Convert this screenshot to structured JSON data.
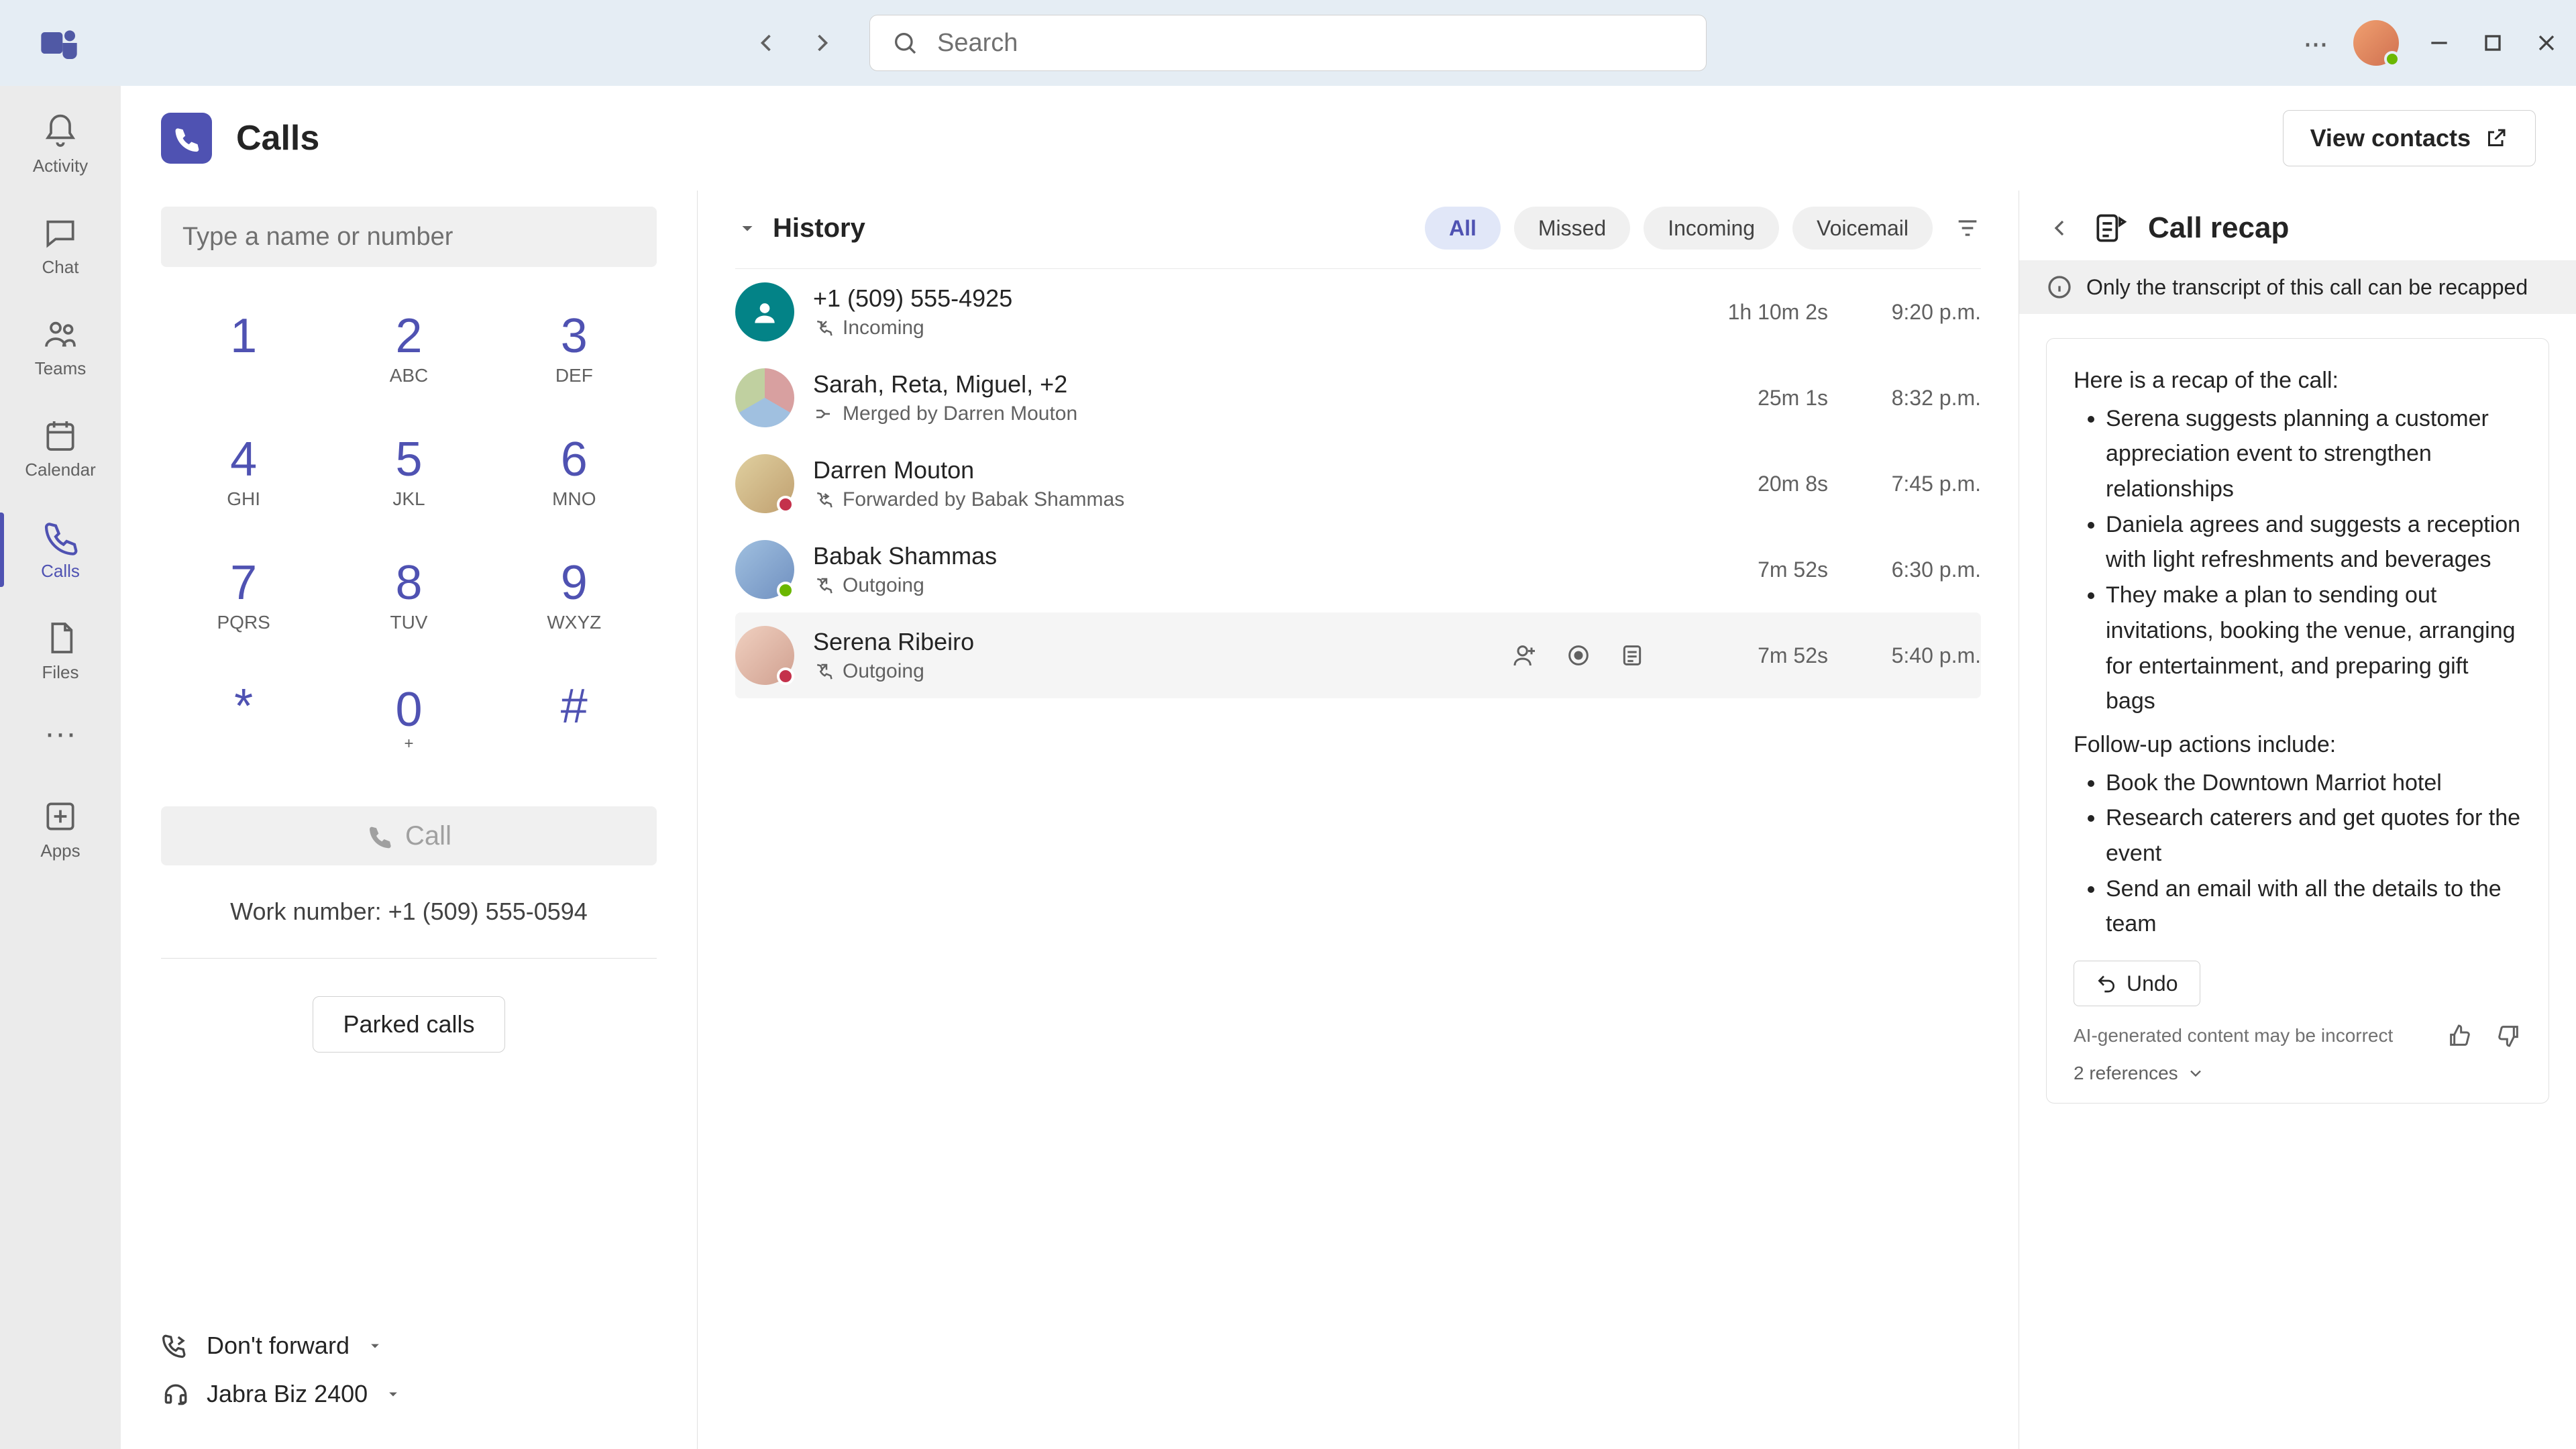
{
  "titlebar": {
    "search_placeholder": "Search"
  },
  "apprail": {
    "items": [
      {
        "label": "Activity"
      },
      {
        "label": "Chat"
      },
      {
        "label": "Teams"
      },
      {
        "label": "Calendar"
      },
      {
        "label": "Calls"
      },
      {
        "label": "Files"
      }
    ],
    "apps_label": "Apps"
  },
  "page": {
    "title": "Calls",
    "view_contacts": "View contacts"
  },
  "dialer": {
    "input_placeholder": "Type a name or number",
    "keys": [
      {
        "d": "1",
        "l": ""
      },
      {
        "d": "2",
        "l": "ABC"
      },
      {
        "d": "3",
        "l": "DEF"
      },
      {
        "d": "4",
        "l": "GHI"
      },
      {
        "d": "5",
        "l": "JKL"
      },
      {
        "d": "6",
        "l": "MNO"
      },
      {
        "d": "7",
        "l": "PQRS"
      },
      {
        "d": "8",
        "l": "TUV"
      },
      {
        "d": "9",
        "l": "WXYZ"
      },
      {
        "d": "*",
        "l": ""
      },
      {
        "d": "0",
        "l": "+"
      },
      {
        "d": "#",
        "l": ""
      }
    ],
    "call_label": "Call",
    "work_number": "Work number: +1 (509) 555-0594",
    "parked_label": "Parked calls",
    "forward_label": "Don't forward",
    "device_label": "Jabra Biz 2400"
  },
  "history": {
    "title": "History",
    "filters": {
      "all": "All",
      "missed": "Missed",
      "incoming": "Incoming",
      "voicemail": "Voicemail"
    },
    "rows": [
      {
        "name": "+1 (509) 555-4925",
        "sub": "Incoming",
        "dur": "1h 10m 2s",
        "time": "9:20 p.m.",
        "type": "incoming",
        "avatar": "teal",
        "presence": ""
      },
      {
        "name": "Sarah, Reta, Miguel, +2",
        "sub": "Merged by Darren Mouton",
        "dur": "25m 1s",
        "time": "8:32 p.m.",
        "type": "merged",
        "avatar": "multi",
        "presence": ""
      },
      {
        "name": "Darren Mouton",
        "sub": "Forwarded by Babak Shammas",
        "dur": "20m 8s",
        "time": "7:45 p.m.",
        "type": "forward",
        "avatar": "img2",
        "presence": "busy"
      },
      {
        "name": "Babak Shammas",
        "sub": "Outgoing",
        "dur": "7m 52s",
        "time": "6:30 p.m.",
        "type": "outgoing",
        "avatar": "img3",
        "presence": "avail"
      },
      {
        "name": "Serena Ribeiro",
        "sub": "Outgoing",
        "dur": "7m 52s",
        "time": "5:40 p.m.",
        "type": "outgoing",
        "avatar": "img4",
        "presence": "busy"
      }
    ]
  },
  "recap": {
    "title": "Call recap",
    "banner": "Only the transcript of this call can be recapped",
    "intro": "Here is a recap of the call:",
    "bullets": [
      "Serena suggests planning a customer appreciation event to strengthen relationships",
      "Daniela agrees and suggests a reception with light refreshments and beverages",
      "They make a plan to sending out invitations, booking the venue, arranging for entertainment, and preparing gift bags"
    ],
    "followup_intro": "Follow-up actions include:",
    "followups": [
      "Book the Downtown Marriot hotel",
      "Research caterers and get quotes for the event",
      "Send an email with all the details to the team"
    ],
    "undo": "Undo",
    "disclaimer": "AI-generated content may be incorrect",
    "references": "2 references"
  }
}
